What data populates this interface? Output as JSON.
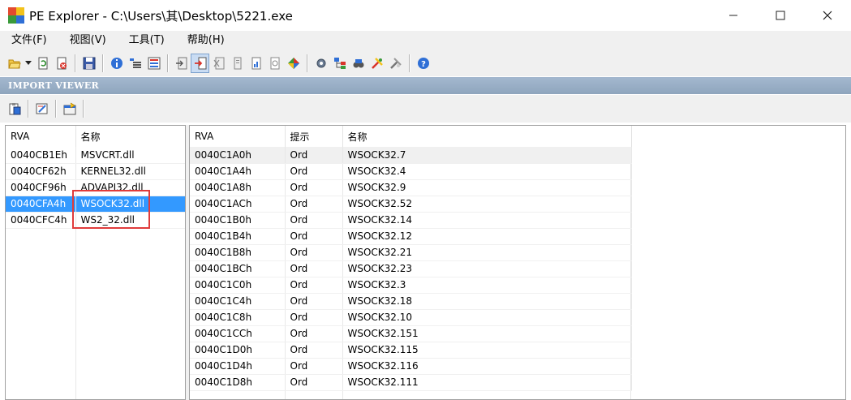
{
  "window": {
    "title": "PE Explorer - C:\\Users\\其\\Desktop\\5221.exe",
    "controls": {
      "minimize": "—",
      "maximize": "☐",
      "close": "✕"
    }
  },
  "menu": {
    "items": [
      "文件(F)",
      "视图(V)",
      "工具(T)",
      "帮助(H)"
    ]
  },
  "section": {
    "title": "IMPORT VIEWER"
  },
  "left_table": {
    "headers": [
      "RVA",
      "名称"
    ],
    "rows": [
      [
        "0040CB1Eh",
        "MSVCRT.dll"
      ],
      [
        "0040CF62h",
        "KERNEL32.dll"
      ],
      [
        "0040CF96h",
        "ADVAPI32.dll"
      ],
      [
        "0040CFA4h",
        "WSOCK32.dll"
      ],
      [
        "0040CFC4h",
        "WS2_32.dll"
      ]
    ],
    "selected_index": 3
  },
  "right_table": {
    "headers": [
      "RVA",
      "提示",
      "名称"
    ],
    "rows": [
      [
        "0040C1A0h",
        "Ord",
        "WSOCK32.7"
      ],
      [
        "0040C1A4h",
        "Ord",
        "WSOCK32.4"
      ],
      [
        "0040C1A8h",
        "Ord",
        "WSOCK32.9"
      ],
      [
        "0040C1ACh",
        "Ord",
        "WSOCK32.52"
      ],
      [
        "0040C1B0h",
        "Ord",
        "WSOCK32.14"
      ],
      [
        "0040C1B4h",
        "Ord",
        "WSOCK32.12"
      ],
      [
        "0040C1B8h",
        "Ord",
        "WSOCK32.21"
      ],
      [
        "0040C1BCh",
        "Ord",
        "WSOCK32.23"
      ],
      [
        "0040C1C0h",
        "Ord",
        "WSOCK32.3"
      ],
      [
        "0040C1C4h",
        "Ord",
        "WSOCK32.18"
      ],
      [
        "0040C1C8h",
        "Ord",
        "WSOCK32.10"
      ],
      [
        "0040C1CCh",
        "Ord",
        "WSOCK32.151"
      ],
      [
        "0040C1D0h",
        "Ord",
        "WSOCK32.115"
      ],
      [
        "0040C1D4h",
        "Ord",
        "WSOCK32.116"
      ],
      [
        "0040C1D8h",
        "Ord",
        "WSOCK32.111"
      ]
    ],
    "hover_index": 0
  },
  "colors": {
    "selection": "#3399ff",
    "annotation": "#e03b3b",
    "section_header": "#98acc3"
  }
}
